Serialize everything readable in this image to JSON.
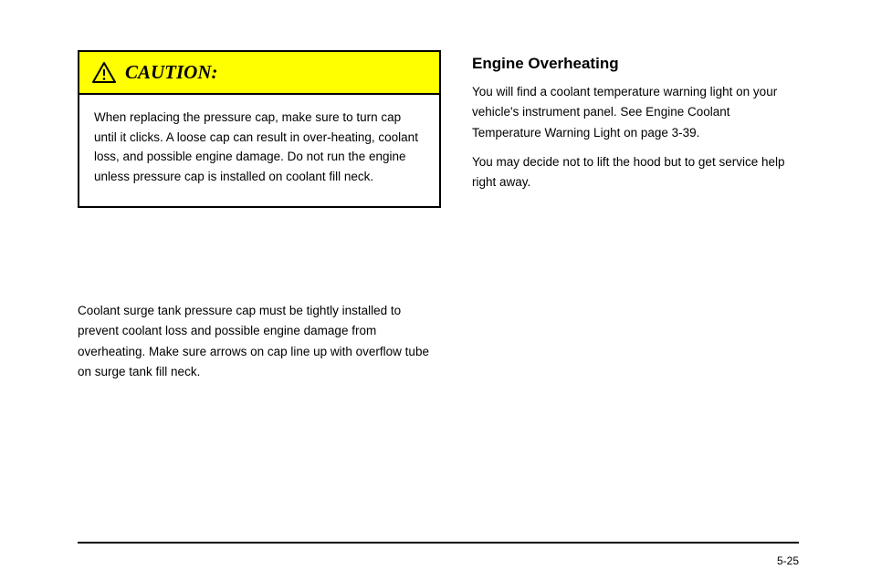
{
  "caution": {
    "title": "CAUTION:",
    "body": "When replacing the pressure cap, make sure to turn cap until it clicks. A loose cap can result in over-heating, coolant loss, and possible engine damage. Do not run the engine unless pressure cap is installed on coolant fill neck."
  },
  "left": {
    "intro": "Coolant surge tank pressure cap must be tightly installed to prevent coolant loss and possible engine damage from overheating. Make sure arrows on cap line up with overflow tube on surge tank fill neck."
  },
  "right": {
    "heading": "Engine Overheating",
    "p1": "You will find a coolant temperature warning light on your vehicle's instrument panel. See Engine Coolant Temperature Warning Light on page 3-39.",
    "p2": "You may decide not to lift the hood but to get service help right away."
  },
  "page_number": "5-25"
}
